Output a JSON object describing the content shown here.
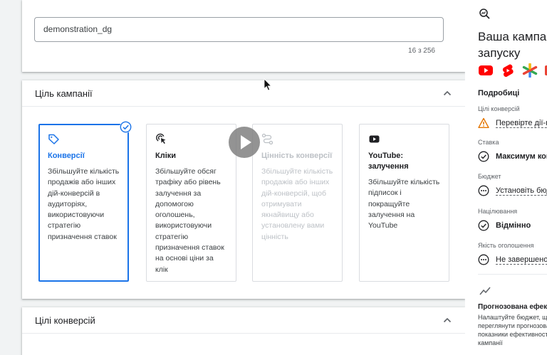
{
  "campaign_name": {
    "value": "demonstration_dg",
    "counter": "16 з 256"
  },
  "goal_section": {
    "title": "Ціль кампанії",
    "options": [
      {
        "title": "Конверсії",
        "desc": "Збільшуйте кількість продажів або інших дій-конверсій в аудиторіях, використовуючи стратегію призначення ставок",
        "state": "selected",
        "icon": "tag-icon"
      },
      {
        "title": "Кліки",
        "desc": "Збільшуйте обсяг трафіку або рівень залучення за допомогою оголошень, використовуючи стратегію призначення ставок на основі ціни за клік",
        "state": "normal",
        "icon": "cursor-click-icon"
      },
      {
        "title": "Цінність конверсії",
        "desc": "Збільшуйте кількість продажів або інших дій-конверсій, щоб отримувати якнайвищу або установлену вами цінність",
        "state": "disabled",
        "icon": "route-icon"
      },
      {
        "title": "YouTube: залучення",
        "desc": "Збільшуйте кількість підписок і покращуйте залучення на YouTube",
        "state": "normal",
        "icon": "youtube-icon"
      }
    ]
  },
  "conversion_section": {
    "title": "Цілі конверсій"
  },
  "sidebar": {
    "title": "Ваша кампанія готова до запуску",
    "details_title": "Подробиці",
    "rows": [
      {
        "label": "Цілі конверсій",
        "value": "Перевірте дії-конверсії",
        "status": "warning"
      },
      {
        "label": "Ставка",
        "value": "Максимум конверсій",
        "status": "ok"
      },
      {
        "label": "Бюджет",
        "value": "Установіть бюджет",
        "status": "pending"
      },
      {
        "label": "Націлювання",
        "value": "Відмінно",
        "status": "ok"
      },
      {
        "label": "Якість оголошення",
        "value": "Не завершено",
        "status": "pending"
      }
    ],
    "perf_title": "Прогнозована ефективність",
    "perf_desc": "Налаштуйте бюджет, щоб\nпереглянути прогнозовані\nпоказники ефективності\nкампанії"
  },
  "colors": {
    "accent": "#1a73e8",
    "warning": "#e37400",
    "disabled": "#bdc1c6"
  }
}
